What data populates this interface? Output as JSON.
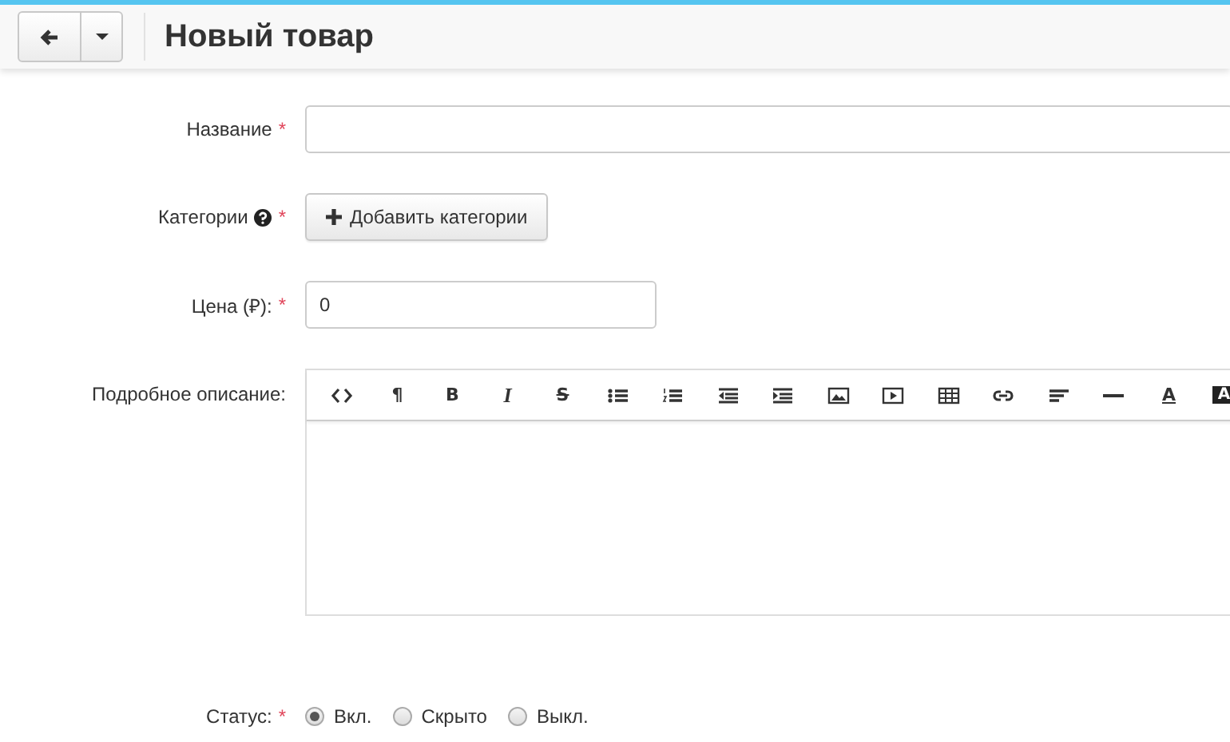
{
  "header": {
    "title": "Новый товар"
  },
  "fields": [
    {
      "kind": "text",
      "label": "Название",
      "required_mark": "*"
    },
    {
      "kind": "category",
      "label": "Категории",
      "help": true,
      "required_mark": "*",
      "button": "Добавить категории"
    },
    {
      "kind": "price",
      "label": "Цена (₽):",
      "required_mark": "*",
      "value": "0"
    },
    {
      "kind": "editor",
      "label": "Подробное описание:",
      "toolbar": [
        {
          "kind": "code"
        },
        {
          "kind": "para",
          "label": "¶"
        },
        {
          "kind": "bold",
          "label": "B"
        },
        {
          "kind": "italic",
          "label": "I"
        },
        {
          "kind": "strike",
          "label": "S"
        },
        {
          "kind": "ul"
        },
        {
          "kind": "ol"
        },
        {
          "kind": "outdent"
        },
        {
          "kind": "indent"
        },
        {
          "kind": "image"
        },
        {
          "kind": "video"
        },
        {
          "kind": "table"
        },
        {
          "kind": "link"
        },
        {
          "kind": "align"
        },
        {
          "kind": "hr"
        },
        {
          "kind": "color",
          "label": "A"
        },
        {
          "kind": "bgcolor",
          "label": "A"
        }
      ]
    },
    {
      "kind": "radio",
      "label": "Статус:",
      "required_mark": "*",
      "options": [
        {
          "label": "Вкл.",
          "selected": true
        },
        {
          "label": "Скрыто",
          "selected": false
        },
        {
          "label": "Выкл.",
          "selected": false
        }
      ]
    }
  ]
}
